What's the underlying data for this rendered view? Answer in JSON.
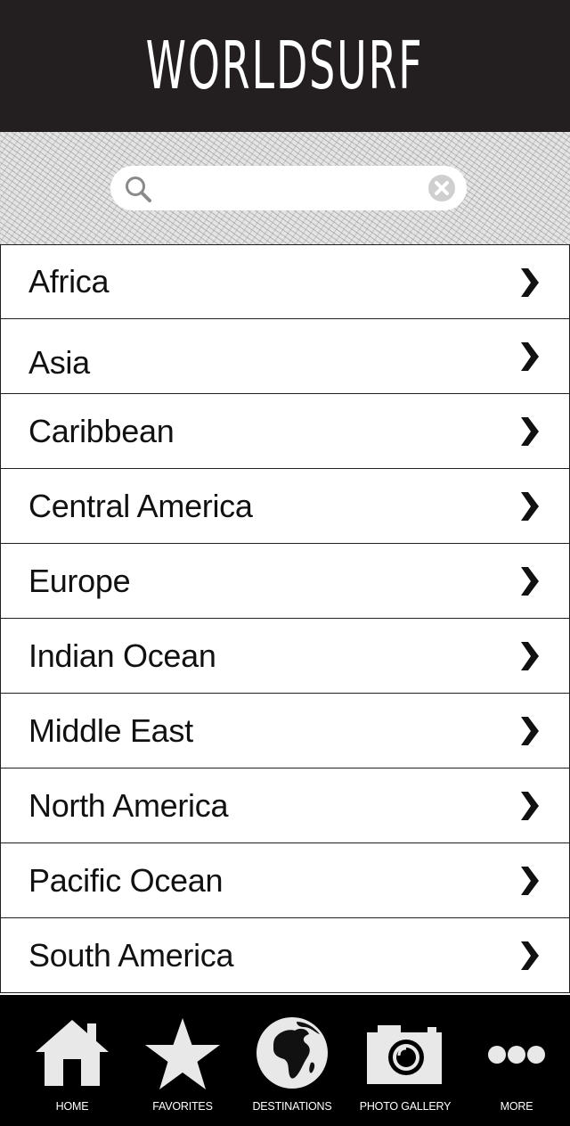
{
  "header": {
    "title": "WORLDSURF"
  },
  "search": {
    "value": "",
    "placeholder": ""
  },
  "regions": [
    "Africa",
    "Asia",
    "Caribbean",
    "Central America",
    "Europe",
    "Indian Ocean",
    "Middle East",
    "North America",
    "Pacific Ocean",
    "South America"
  ],
  "tabs": [
    {
      "label": "HOME",
      "icon": "home-icon"
    },
    {
      "label": "FAVORITES",
      "icon": "star-icon"
    },
    {
      "label": "DESTINATIONS",
      "icon": "globe-icon"
    },
    {
      "label": "PHOTO GALLERY",
      "icon": "camera-icon"
    },
    {
      "label": "MORE",
      "icon": "more-icon"
    }
  ],
  "colors": {
    "header_bg": "#231f20",
    "tabbar_bg": "#000000",
    "icon_fill": "#e8e8e8"
  }
}
